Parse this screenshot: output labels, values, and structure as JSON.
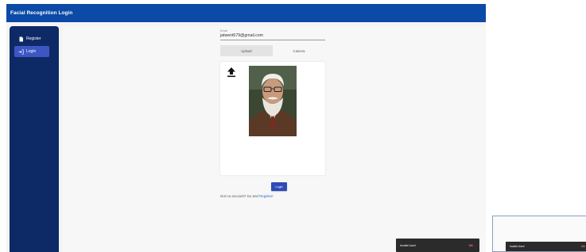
{
  "app": {
    "title": "Facial Recognition Login"
  },
  "sidebar": {
    "items": [
      {
        "label": "Register",
        "icon": "person-add-icon"
      },
      {
        "label": "Login",
        "icon": "login-icon",
        "active": true
      }
    ]
  },
  "form": {
    "email_label": "Email",
    "email_value": "jatwent679@gmail.com",
    "tabs": [
      {
        "label": "Upload",
        "active": true
      },
      {
        "label": "Camera"
      }
    ],
    "upload_icon": "upload-arrow-icon",
    "login_label": "Login",
    "signup_text": "Got no account? Go and",
    "signup_link": "Register!"
  },
  "snackbar": {
    "message": "Invalid User!",
    "action": "OK"
  },
  "snackbar_secondary": {
    "message": "Invalid User!",
    "action": "OK"
  },
  "colors": {
    "appbar": "#0b4aa6",
    "sidebar": "#0d2a66",
    "active_nav": "#3d56c4",
    "button": "#2f4bb8",
    "link": "#2f6ad0",
    "snackbar": "#2b2b2b",
    "snackbar_action": "#ff6b6b"
  }
}
